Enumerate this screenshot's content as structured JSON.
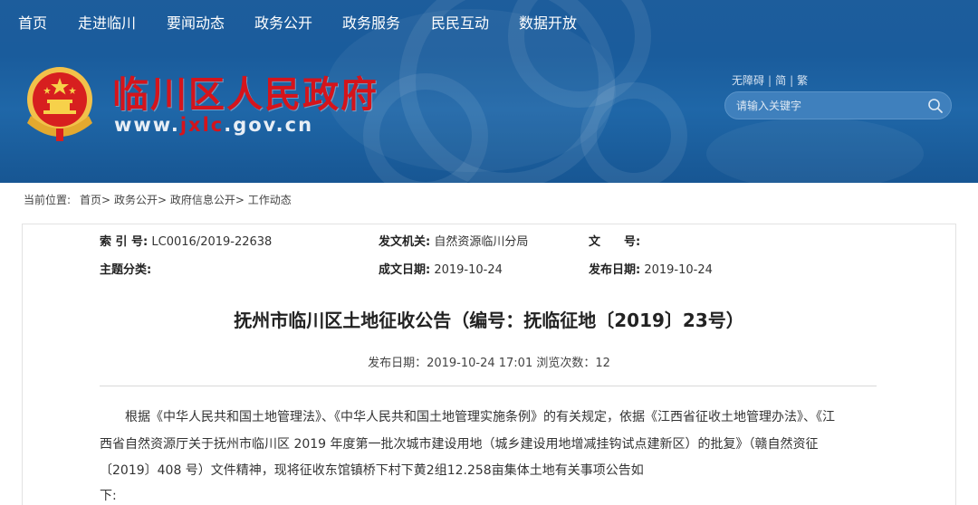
{
  "nav": [
    "首页",
    "走进临川",
    "要闻动态",
    "政务公开",
    "政务服务",
    "民民互动",
    "数据开放"
  ],
  "site": {
    "title": "临川区人民政府",
    "url_prefix": "www.",
    "url_highlight": "jxlc",
    "url_suffix": ".gov.cn"
  },
  "access": {
    "no_barrier": "无障碍",
    "sep": "|",
    "simplified": "简",
    "traditional": "繁"
  },
  "search": {
    "placeholder": "请输入关键字"
  },
  "breadcrumb": {
    "label": "当前位置:",
    "items": [
      "首页>",
      "政务公开>",
      "政府信息公开>",
      "工作动态"
    ]
  },
  "meta": {
    "index_label": "索 引 号:",
    "index_value": "LC0016/2019-22638",
    "issuer_label": "发文机关:",
    "issuer_value": "自然资源临川分局",
    "docno_label": "文　　号:",
    "docno_value": "",
    "topic_label": "主题分类:",
    "topic_value": "",
    "created_label": "成文日期:",
    "created_value": "2019-10-24",
    "published_label": "发布日期:",
    "published_value": "2019-10-24"
  },
  "article": {
    "title": "抚州市临川区土地征收公告（编号：抚临征地〔2019〕23号）",
    "pub_info": "发布日期：2019-10-24 17:01 浏览次数：12",
    "lines": [
      "根据《中华人民共和国土地管理法》、《中华人民共和国土地管理实施条例》的有关规定，依据《江西省征收土地管理办法》、《江",
      "西省自然资源厅关于抚州市临川区 2019 年度第一批次城市建设用地（城乡建设用地增减挂钩试点建新区）的批复》（赣自然资征",
      "〔2019〕408 号）文件精神，现将征收东馆镇桥下村下黄2组12.258亩集体土地有关事项公告如",
      "下:"
    ]
  },
  "colors": {
    "header_bg": "#1a5c9c",
    "title_red": "#d5141b"
  },
  "icons": {
    "search": "search-icon",
    "emblem": "national-emblem-icon"
  }
}
